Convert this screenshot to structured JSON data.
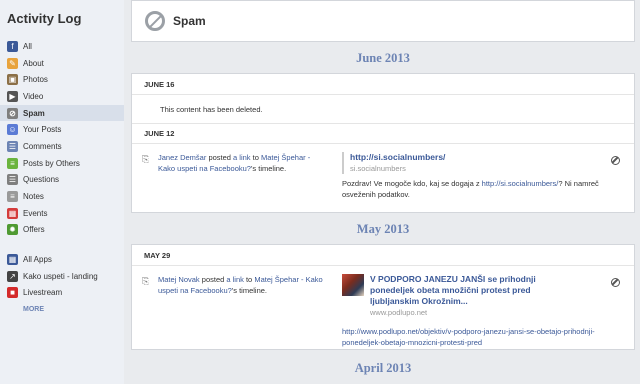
{
  "sidebar": {
    "title": "Activity Log",
    "items": [
      {
        "label": "All",
        "icon": "facebook-icon",
        "color": "#3b5998"
      },
      {
        "label": "About",
        "icon": "pencil-icon",
        "color": "#e8a33d"
      },
      {
        "label": "Photos",
        "icon": "photo-icon",
        "color": "#8b6f47"
      },
      {
        "label": "Video",
        "icon": "video-camera-icon",
        "color": "#555555"
      },
      {
        "label": "Spam",
        "icon": "spam-icon",
        "color": "#7f7f7f",
        "active": true
      },
      {
        "label": "Your Posts",
        "icon": "person-icon",
        "color": "#5b7bd5"
      },
      {
        "label": "Comments",
        "icon": "comment-icon",
        "color": "#6d84b4"
      },
      {
        "label": "Posts by Others",
        "icon": "chat-icon",
        "color": "#6bb43f"
      },
      {
        "label": "Questions",
        "icon": "list-icon",
        "color": "#7f7f7f"
      },
      {
        "label": "Notes",
        "icon": "note-icon",
        "color": "#9a9a9a"
      },
      {
        "label": "Events",
        "icon": "calendar-icon",
        "color": "#d43c3c"
      },
      {
        "label": "Offers",
        "icon": "offer-icon",
        "color": "#4f9a32"
      }
    ],
    "apps": [
      {
        "label": "All Apps",
        "icon": "apps-icon",
        "color": "#3b5998"
      },
      {
        "label": "Kako uspeti - landing",
        "icon": "chart-icon",
        "color": "#444444"
      },
      {
        "label": "Livestream",
        "icon": "livestream-icon",
        "color": "#d42a2a"
      }
    ],
    "more": "MORE"
  },
  "header": {
    "title": "Spam"
  },
  "sections": {
    "june_2013": "June 2013",
    "may_2013": "May 2013",
    "april_2013": "April 2013"
  },
  "june16": {
    "date": "JUNE 16",
    "text": "This content has been deleted."
  },
  "june12": {
    "date": "JUNE 12",
    "actor": "Janez Demšar",
    "posted": " posted ",
    "a_link": "a link",
    "to": " to ",
    "target": "Matej Špehar - Kako uspeti na Facebooku?",
    "suffix": "'s timeline.",
    "link_title": "http://si.socialnumbers/",
    "link_domain": "si.socialnumbers",
    "message_pre": "Pozdrav! Ve mogoče kdo, kaj se dogaja z ",
    "message_link": "http://si.socialnumbers/",
    "message_post": "? Ni namreč osveženih podatkov."
  },
  "may29": {
    "date": "MAY 29",
    "actor": "Matej Novak",
    "posted": " posted ",
    "a_link": "a link",
    "to": " to ",
    "target": "Matej Špehar - Kako uspeti na Facebooku?",
    "suffix": "'s timeline.",
    "link_title": "V PODPORO JANEZU JANŠI se prihodnji ponedeljek obeta množični protest pred ljubljanskim Okrožnim...",
    "link_domain": "www.podlupo.net",
    "url": "http://www.podlupo.net/objektiv/v-podporo-janezu-jansi-se-obetajo-prihodnji-ponedeljek-obetajo-mnozicni-protesti-pred"
  }
}
